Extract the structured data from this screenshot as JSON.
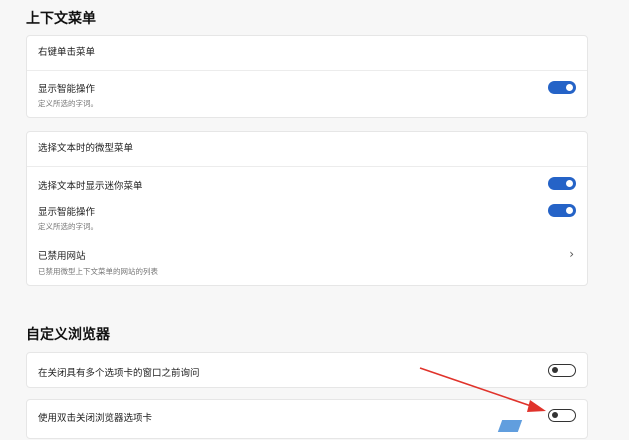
{
  "context_menu": {
    "title": "上下文菜单",
    "right_click_card": {
      "header": "右键单击菜单",
      "smart_actions": {
        "label": "显示智能操作",
        "desc": "定义所选的字词。",
        "enabled": true
      }
    },
    "mini_menu_card": {
      "header": "选择文本时的微型菜单",
      "show_mini_menu": {
        "label": "选择文本时显示迷你菜单",
        "enabled": true
      },
      "smart_actions": {
        "label": "显示智能操作",
        "desc": "定义所选的字词。",
        "enabled": true
      },
      "disabled_sites": {
        "label": "已禁用网站",
        "desc": "已禁用微型上下文菜单的网站的列表"
      }
    }
  },
  "customize_browser": {
    "title": "自定义浏览器",
    "ask_before_close": {
      "label": "在关闭具有多个选项卡的窗口之前询问",
      "enabled": false
    },
    "double_click_close": {
      "label": "使用双击关闭浏览器选项卡",
      "enabled": false
    }
  },
  "colors": {
    "accent": "#2563c7",
    "annotation_arrow": "#e0332b"
  }
}
